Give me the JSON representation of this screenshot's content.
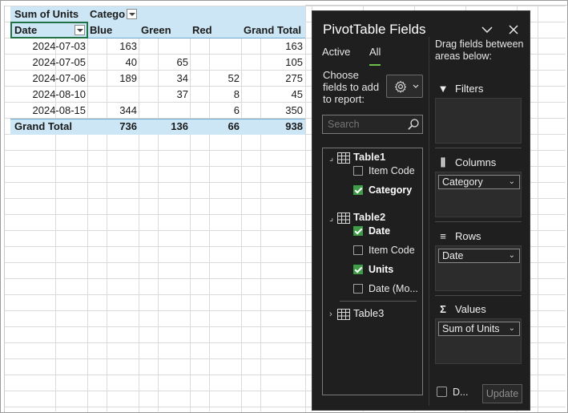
{
  "pivot": {
    "header_row1": {
      "values_label": "Sum of Units",
      "col_field": "Catego"
    },
    "header_row2": {
      "row_field": "Date",
      "columns": [
        "Blue",
        "Green",
        "Red",
        "Grand Total"
      ]
    },
    "rows": [
      {
        "date": "2024-07-03",
        "blue": "163",
        "green": "",
        "red": "",
        "total": "163"
      },
      {
        "date": "2024-07-05",
        "blue": "40",
        "green": "65",
        "red": "",
        "total": "105"
      },
      {
        "date": "2024-07-06",
        "blue": "189",
        "green": "34",
        "red": "52",
        "total": "275"
      },
      {
        "date": "2024-08-10",
        "blue": "",
        "green": "37",
        "red": "8",
        "total": "45"
      },
      {
        "date": "2024-08-15",
        "blue": "344",
        "green": "",
        "red": "6",
        "total": "350"
      }
    ],
    "grand_total": {
      "label": "Grand Total",
      "blue": "736",
      "green": "136",
      "red": "66",
      "total": "938"
    }
  },
  "pane": {
    "title": "PivotTable Fields",
    "tabs": {
      "active": "Active",
      "all": "All"
    },
    "choose_label": [
      "Choose",
      "fields to add",
      "to report:"
    ],
    "search_placeholder": "Search",
    "tables": [
      {
        "name": "Table1",
        "fields": [
          {
            "label": "Item Code",
            "checked": false
          },
          {
            "label": "Category",
            "checked": true
          }
        ]
      },
      {
        "name": "Table2",
        "fields": [
          {
            "label": "Date",
            "checked": true
          },
          {
            "label": "Item Code",
            "checked": false
          },
          {
            "label": "Units",
            "checked": true
          },
          {
            "label": "Date (Mo...",
            "checked": false
          }
        ]
      },
      {
        "name": "Table3",
        "fields": []
      }
    ],
    "drag_label": [
      "Drag fields between",
      "areas below:"
    ],
    "areas": {
      "filters": {
        "label": "Filters",
        "items": []
      },
      "columns": {
        "label": "Columns",
        "items": [
          "Category"
        ]
      },
      "rows": {
        "label": "Rows",
        "items": [
          "Date"
        ]
      },
      "values": {
        "label": "Values",
        "items": [
          "Sum of Units"
        ]
      }
    },
    "defer_label": "D...",
    "update_label": "Update"
  }
}
